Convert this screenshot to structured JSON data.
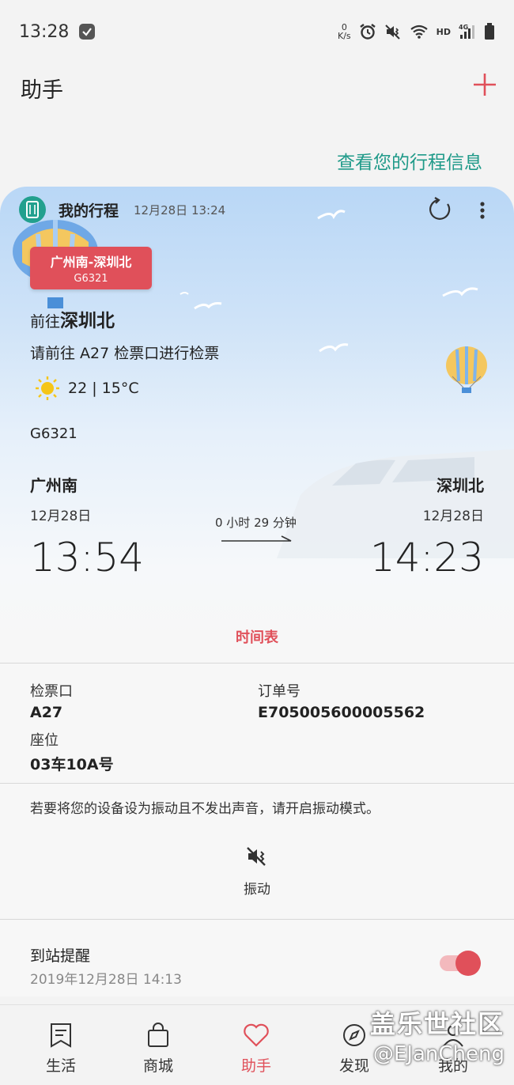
{
  "status_bar": {
    "time": "13:28",
    "net_speed_value": "0",
    "net_speed_unit": "K/s",
    "hd_label": "HD",
    "network_label": "4G"
  },
  "header": {
    "title": "助手"
  },
  "trip_link": "查看您的行程信息",
  "card": {
    "title": "我的行程",
    "time": "12月28日 13:24",
    "route_badge": {
      "route": "广州南-深圳北",
      "train": "G6321"
    },
    "dest_prefix": "前往",
    "dest_name": "深圳北",
    "gate_text": "请前往 A27 检票口进行检票",
    "weather": "22 | 15°C",
    "train_no": "G6321",
    "from_station": "广州南",
    "to_station": "深圳北",
    "from_date": "12月28日",
    "to_date": "12月28日",
    "duration": "0 小时 29 分钟",
    "from_time": "13:54",
    "to_time": "14:23",
    "timetable_label": "时间表",
    "details": {
      "gate_label": "检票口",
      "gate_value": "A27",
      "order_label": "订单号",
      "order_value": "E705005600005562",
      "seat_label": "座位",
      "seat_value": "03车10A号"
    },
    "vibrate_note": "若要将您的设备设为振动且不发出声音，请开启振动模式。",
    "vibrate_label": "振动",
    "arrival_title": "到站提醒",
    "arrival_time": "2019年12月28日 14:13",
    "arrival_enabled": true
  },
  "colors": {
    "accent": "#e0505a",
    "teal": "#1f9a89"
  },
  "bottom_nav": [
    {
      "label": "生活",
      "icon": "bookmark-icon"
    },
    {
      "label": "商城",
      "icon": "shopping-bag-icon"
    },
    {
      "label": "助手",
      "icon": "heart-icon",
      "active": true
    },
    {
      "label": "发现",
      "icon": "compass-icon"
    },
    {
      "label": "我的",
      "icon": "person-icon"
    }
  ],
  "watermark": {
    "line1": "盖乐世社区",
    "line2": "@EJanCheng"
  }
}
